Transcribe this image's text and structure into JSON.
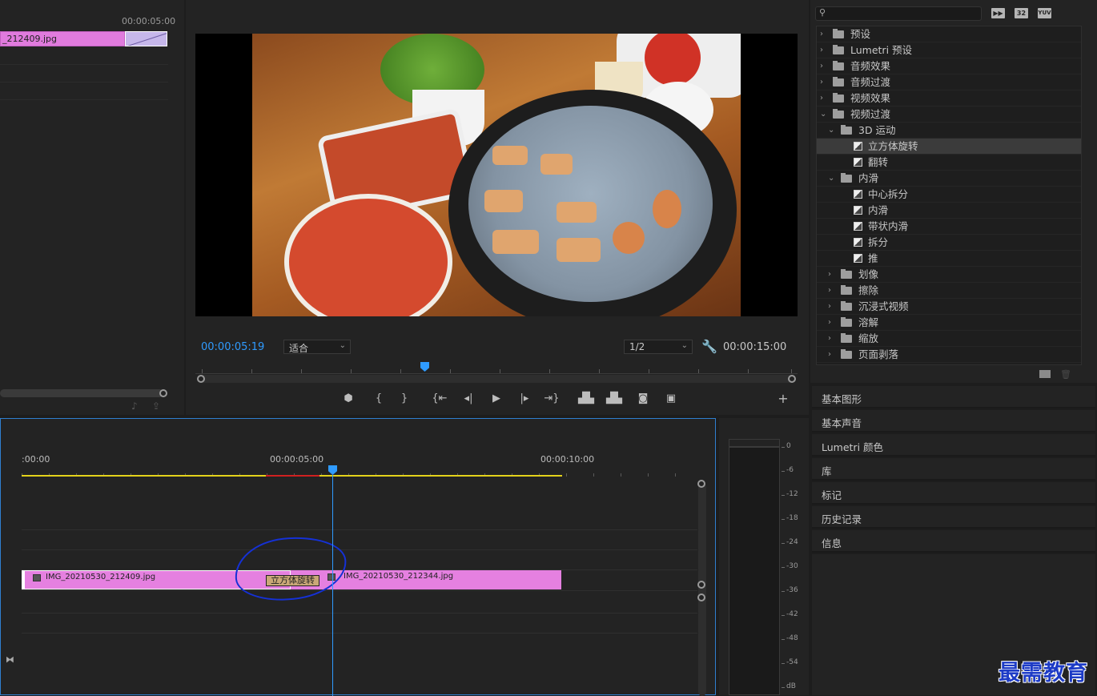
{
  "source": {
    "timecode": "00:00:05:00",
    "clip_name": "_212409.jpg"
  },
  "program": {
    "timecode_current": "00:00:05:19",
    "zoom": "适合",
    "resolution": "1/2",
    "timecode_duration": "00:00:15:00"
  },
  "effects": {
    "badges": [
      "32",
      "YUV"
    ],
    "tree": [
      {
        "label": "预设",
        "depth": 0,
        "kind": "preset",
        "expanded": false
      },
      {
        "label": "Lumetri 预设",
        "depth": 0,
        "kind": "preset",
        "expanded": false
      },
      {
        "label": "音频效果",
        "depth": 0,
        "kind": "folder",
        "expanded": false
      },
      {
        "label": "音频过渡",
        "depth": 0,
        "kind": "folder",
        "expanded": false
      },
      {
        "label": "视频效果",
        "depth": 0,
        "kind": "folder",
        "expanded": false
      },
      {
        "label": "视频过渡",
        "depth": 0,
        "kind": "folder",
        "expanded": true
      },
      {
        "label": "3D 运动",
        "depth": 1,
        "kind": "folder",
        "expanded": true
      },
      {
        "label": "立方体旋转",
        "depth": 2,
        "kind": "fx",
        "selected": true
      },
      {
        "label": "翻转",
        "depth": 2,
        "kind": "fx"
      },
      {
        "label": "内滑",
        "depth": 1,
        "kind": "folder",
        "expanded": true
      },
      {
        "label": "中心拆分",
        "depth": 2,
        "kind": "fx"
      },
      {
        "label": "内滑",
        "depth": 2,
        "kind": "fx"
      },
      {
        "label": "带状内滑",
        "depth": 2,
        "kind": "fx"
      },
      {
        "label": "拆分",
        "depth": 2,
        "kind": "fx"
      },
      {
        "label": "推",
        "depth": 2,
        "kind": "fx"
      },
      {
        "label": "划像",
        "depth": 1,
        "kind": "folder",
        "expanded": false
      },
      {
        "label": "擦除",
        "depth": 1,
        "kind": "folder",
        "expanded": false
      },
      {
        "label": "沉浸式视频",
        "depth": 1,
        "kind": "folder",
        "expanded": false
      },
      {
        "label": "溶解",
        "depth": 1,
        "kind": "folder",
        "expanded": false
      },
      {
        "label": "缩放",
        "depth": 1,
        "kind": "folder",
        "expanded": false
      },
      {
        "label": "页面剥落",
        "depth": 1,
        "kind": "folder",
        "expanded": false
      }
    ]
  },
  "panels": [
    "基本图形",
    "基本声音",
    "Lumetri 颜色",
    "库",
    "标记",
    "历史记录",
    "信息"
  ],
  "timeline": {
    "ruler_labels": [
      ":00:00",
      "00:00:05:00",
      "00:00:10:00"
    ],
    "clip_a": "IMG_20210530_212409.jpg",
    "clip_b": "IMG_20210530_212344.jpg",
    "transition": "立方体旋转"
  },
  "meter": {
    "db_labels": [
      "0",
      "-6",
      "-12",
      "-18",
      "-24",
      "-30",
      "-36",
      "-42",
      "-48",
      "-54",
      "dB"
    ]
  },
  "watermark": "最需教育",
  "colors": {
    "accent_blue": "#2f9bff",
    "clip_pink": "#e580e0",
    "work_area_yellow": "#e3d21a",
    "annotation_circle": "#1531d6"
  }
}
